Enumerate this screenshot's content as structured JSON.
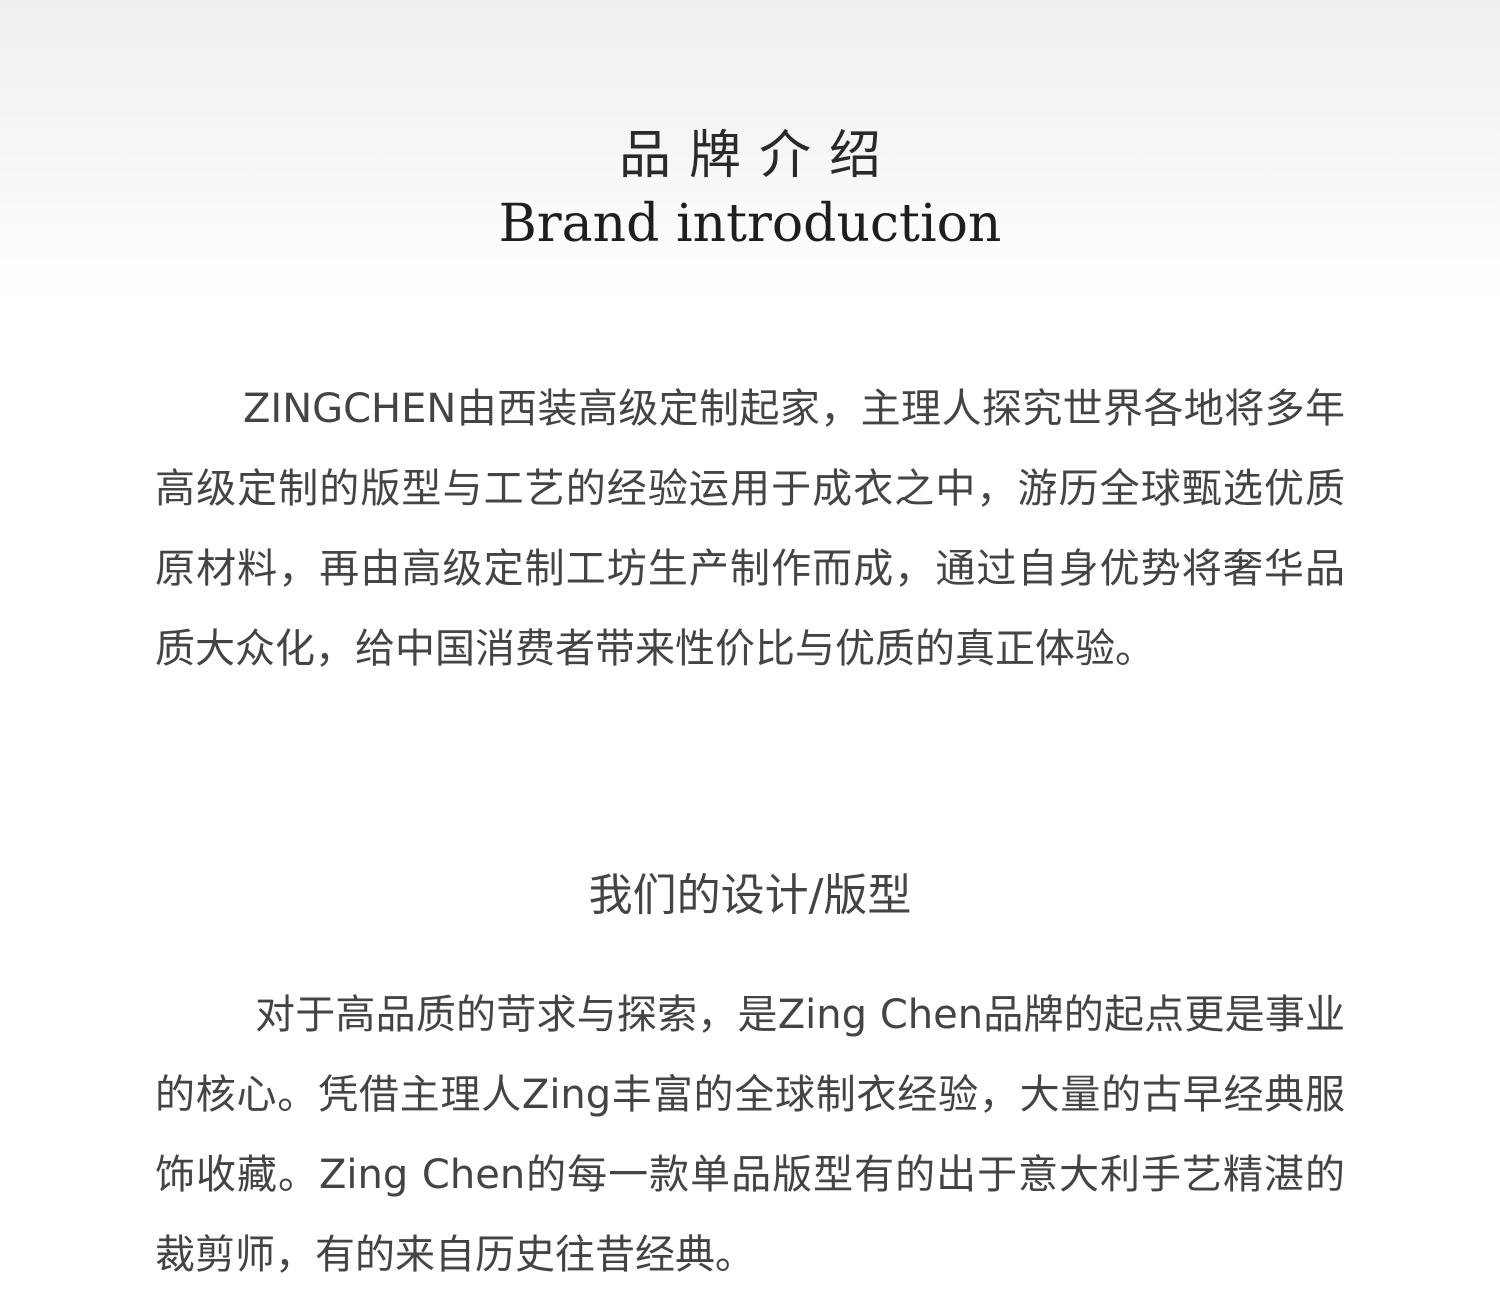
{
  "header": {
    "title_zh": "品牌介绍",
    "title_en": "Brand introduction"
  },
  "intro": {
    "paragraph": "ZINGCHEN由西装高级定制起家，主理人探究世界各地将多年高级定制的版型与工艺的经验运用于成衣之中，游历全球甄选优质原材料，再由高级定制工坊生产制作而成，通过自身优势将奢华品质大众化，给中国消费者带来性价比与优质的真正体验。"
  },
  "design": {
    "heading": "我们的设计/版型",
    "paragraph": "对于高品质的苛求与探索，是Zing Chen品牌的起点更是事业的核心。凭借主理人Zing丰富的全球制衣经验，大量的古早经典服饰收藏。Zing Chen的每一款单品版型有的出于意大利手艺精湛的裁剪师，有的来自历史往昔经典。"
  }
}
